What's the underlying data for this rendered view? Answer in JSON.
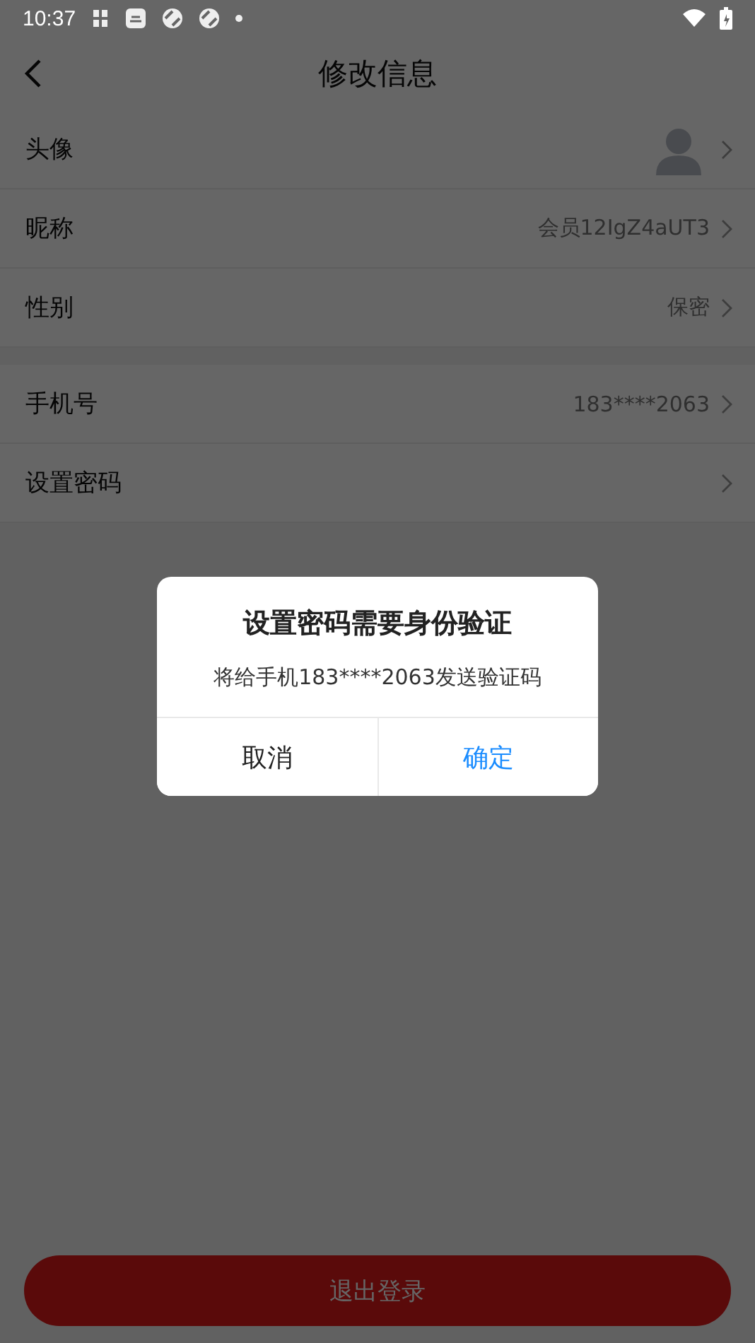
{
  "status_bar": {
    "time": "10:37"
  },
  "header": {
    "title": "修改信息"
  },
  "groups": [
    {
      "rows": [
        {
          "kind": "avatar",
          "label": "头像"
        },
        {
          "kind": "value",
          "label": "昵称",
          "value": "会员12IgZ4aUT3"
        },
        {
          "kind": "value",
          "label": "性别",
          "value": "保密"
        }
      ]
    },
    {
      "rows": [
        {
          "kind": "value",
          "label": "手机号",
          "value": "183****2063"
        },
        {
          "kind": "link",
          "label": "设置密码"
        }
      ]
    }
  ],
  "logout_button": {
    "label": "退出登录"
  },
  "dialog": {
    "title": "设置密码需要身份验证",
    "message": "将给手机183****2063发送验证码",
    "buttons": [
      {
        "kind": "cancel",
        "label": "取消"
      },
      {
        "kind": "confirm",
        "label": "确定"
      }
    ]
  }
}
